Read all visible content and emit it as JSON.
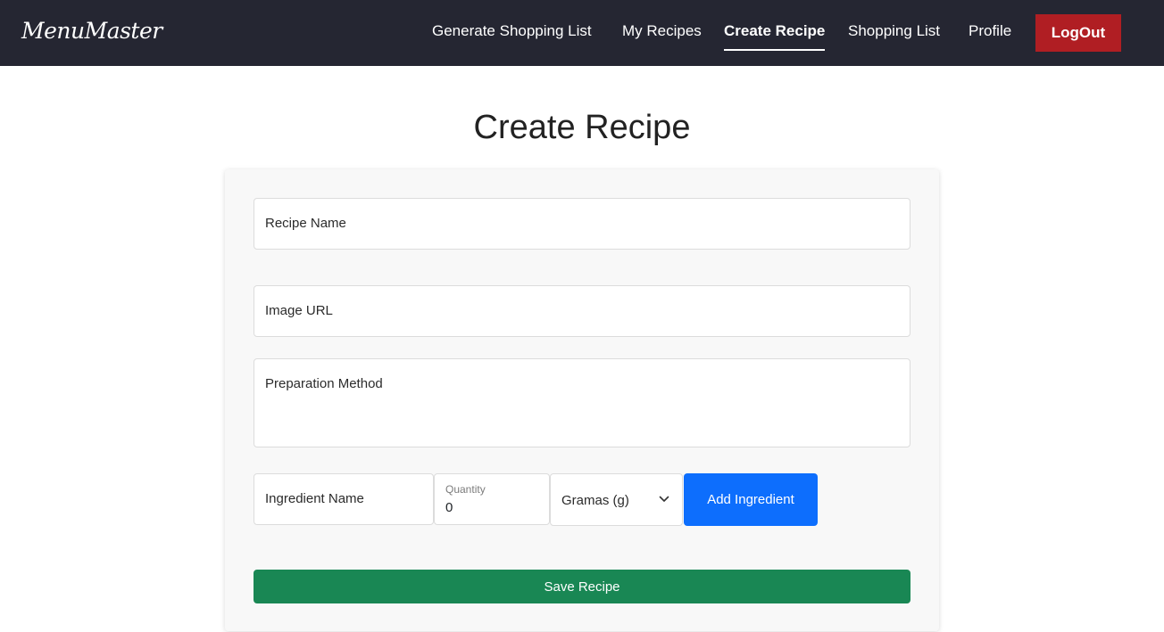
{
  "navbar": {
    "brand": "MenuMaster",
    "links": [
      {
        "label": "Generate Shopping List"
      },
      {
        "label": "My Recipes"
      },
      {
        "label": "Create Recipe",
        "active": true
      },
      {
        "label": "Shopping List"
      },
      {
        "label": "Profile"
      }
    ],
    "logout_label": "LogOut"
  },
  "page": {
    "title": "Create Recipe"
  },
  "form": {
    "recipe_name_placeholder": "Recipe Name",
    "image_url_placeholder": "Image URL",
    "preparation_placeholder": "Preparation Method",
    "ingredient_name_placeholder": "Ingredient Name",
    "quantity_label": "Quantity",
    "quantity_value": "0",
    "unit_selected": "Gramas (g)",
    "add_ingredient_label": "Add Ingredient",
    "save_label": "Save Recipe"
  },
  "colors": {
    "navbar_bg": "#252632",
    "logout_bg": "#b01e23",
    "add_button_bg": "#0d6efd",
    "save_button_bg": "#198754"
  },
  "icons": {
    "unit_dropdown": "chevron-down-icon"
  }
}
